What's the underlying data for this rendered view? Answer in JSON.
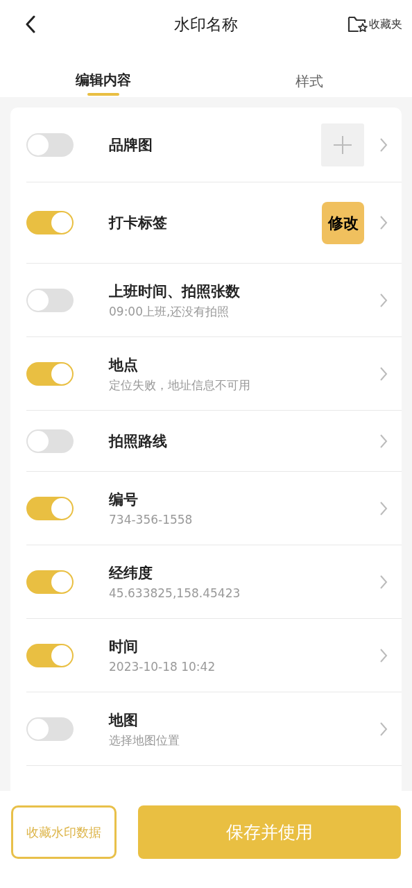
{
  "header": {
    "title": "水印名称",
    "favorites": "收藏夹"
  },
  "tabs": [
    {
      "label": "编辑内容",
      "selected": true
    },
    {
      "label": "样式",
      "selected": false
    }
  ],
  "rows": [
    {
      "title": "品牌图",
      "on": false,
      "action": {
        "kind": "add"
      }
    },
    {
      "title": "打卡标签",
      "on": true,
      "action": {
        "kind": "tag",
        "label": "修改"
      }
    },
    {
      "title": "上班时间、拍照张数",
      "on": false,
      "subtitle": "09:00上班,还没有拍照"
    },
    {
      "title": "地点",
      "on": true,
      "subtitle": "定位失败，地址信息不可用"
    },
    {
      "title": "拍照路线",
      "on": false
    },
    {
      "title": "编号",
      "on": true,
      "subtitle": "734-356-1558"
    },
    {
      "title": "经纬度",
      "on": true,
      "subtitle": "45.633825,158.45423"
    },
    {
      "title": "时间",
      "on": true,
      "subtitle": "2023-10-18 10:42"
    },
    {
      "title": "地图",
      "on": false,
      "subtitle": "选择地图位置"
    }
  ],
  "footer": {
    "secondary": "收藏水印数据",
    "primary": "保存并使用"
  }
}
